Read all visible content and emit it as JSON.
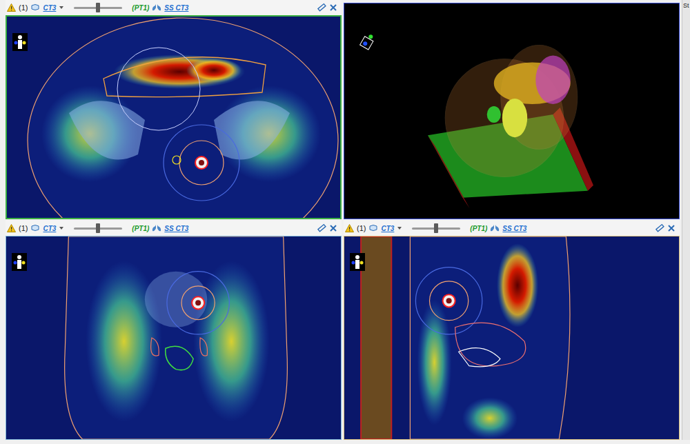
{
  "panels": [
    {
      "kind": "axial",
      "selected": true,
      "color": "#3cb043",
      "toolbar": {
        "warning": "(1)",
        "series": "CT3",
        "slider_level": 0.5,
        "fusion": "(PT1)",
        "structure_set": "SS CT3"
      }
    },
    {
      "kind": "3d",
      "selected": false,
      "color": "#3b4fd8"
    },
    {
      "kind": "coronal",
      "selected": false,
      "color": "#7fb6d8",
      "toolbar": {
        "warning": "(1)",
        "series": "CT3",
        "slider_level": 0.5,
        "fusion": "(PT1)",
        "structure_set": "SS CT3"
      }
    },
    {
      "kind": "sagittal",
      "selected": false,
      "color": "#d8c27f",
      "toolbar": {
        "warning": "(1)",
        "series": "CT3",
        "slider_level": 0.5,
        "fusion": "(PT1)",
        "structure_set": "SS CT3"
      }
    }
  ],
  "sidebar": {
    "label": "St"
  }
}
